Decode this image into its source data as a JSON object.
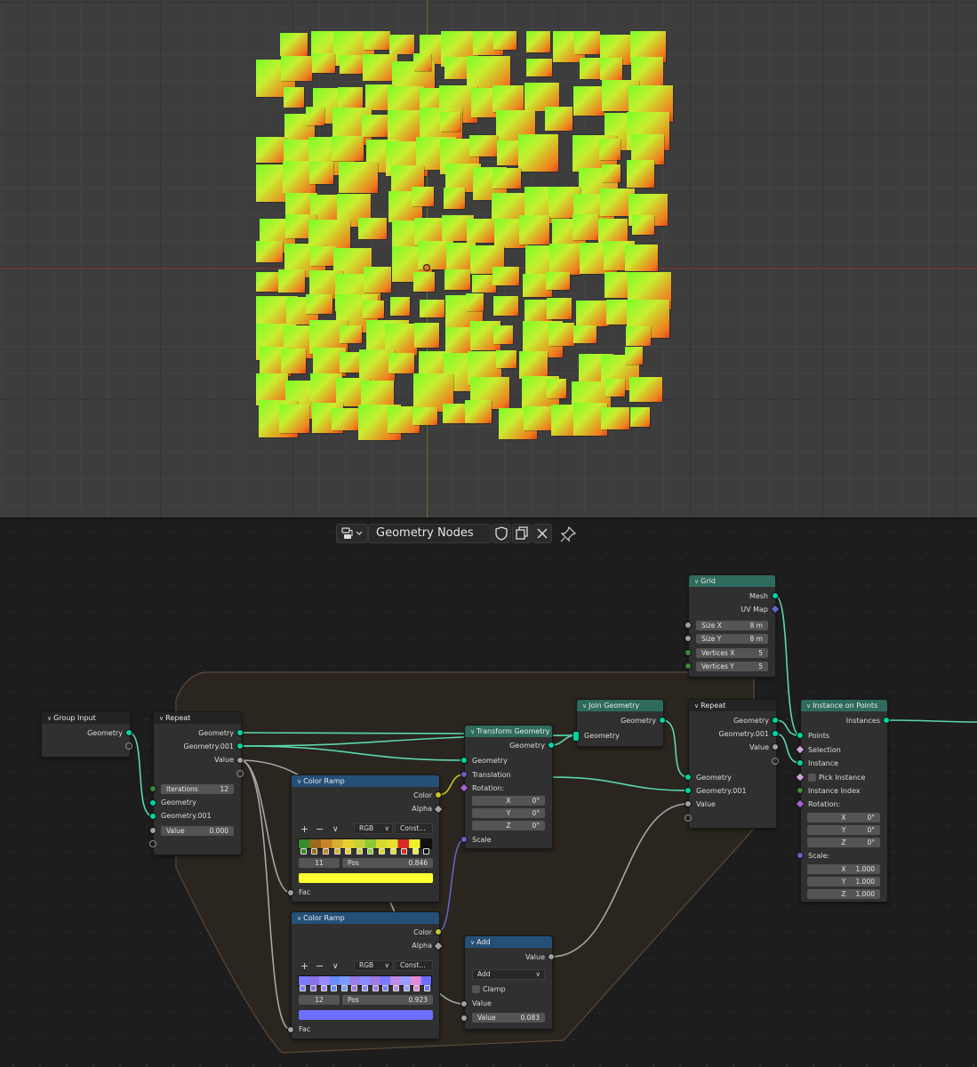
{
  "editor": {
    "tree_name": "Geometry Nodes",
    "colors": {
      "geometry_link": "#5cd6ad",
      "value_link": "#a6a6a6",
      "vector_link": "#6363c7",
      "color_link": "#c7c729",
      "frame_fill": "#2c2620",
      "frame_border": "#5a4a38"
    }
  },
  "nodes": {
    "grid": {
      "title": "Grid",
      "outputs": [
        "Mesh",
        "UV Map"
      ],
      "size_x": {
        "label": "Size X",
        "value": "8 m"
      },
      "size_y": {
        "label": "Size Y",
        "value": "8 m"
      },
      "vertices_x": {
        "label": "Vertices X",
        "value": "5"
      },
      "vertices_y": {
        "label": "Vertices Y",
        "value": "5"
      }
    },
    "group_input": {
      "title": "Group Input",
      "outputs": [
        "Geometry"
      ]
    },
    "repeat_input": {
      "title": "Repeat",
      "outputs": [
        "Geometry",
        "Geometry.001",
        "Value"
      ],
      "iterations": {
        "label": "Iterations",
        "value": "12"
      },
      "inputs": [
        "Geometry",
        "Geometry.001"
      ],
      "value": {
        "label": "Value",
        "value": "0.000"
      }
    },
    "color_ramp_1": {
      "title": "Color Ramp",
      "outputs": [
        "Color",
        "Alpha"
      ],
      "mode": "RGB",
      "interp": "Const...",
      "index": "11",
      "pos_label": "Pos",
      "pos": "0.846",
      "active_color": "#ffff33",
      "stops": [
        "#3a8a2a",
        "#9a6a1a",
        "#c8822a",
        "#d6b030",
        "#e6d030",
        "#c8d03a",
        "#8cc83a",
        "#d8d830",
        "#e6e030",
        "#d82a2a",
        "#f0f030",
        "#111111"
      ],
      "input": "Fac"
    },
    "color_ramp_2": {
      "title": "Color Ramp",
      "outputs": [
        "Color",
        "Alpha"
      ],
      "mode": "RGB",
      "interp": "Const...",
      "index": "12",
      "pos_label": "Pos",
      "pos": "0.923",
      "active_color": "#6e6eff",
      "stops": [
        "#7a7aff",
        "#8a70e6",
        "#9a8aff",
        "#6a8aff",
        "#7a9aff",
        "#9a7ae6",
        "#8a8aff",
        "#a07ae6",
        "#7a7aff",
        "#c08ae6",
        "#9a9aff",
        "#e08ad6",
        "#6e6eff"
      ],
      "input": "Fac"
    },
    "transform": {
      "title": "Transform Geometry",
      "outputs": [
        "Geometry"
      ],
      "inputs": [
        "Geometry",
        "Translation",
        "Rotation:",
        "Scale"
      ],
      "rotation": [
        {
          "label": "X",
          "value": "0°"
        },
        {
          "label": "Y",
          "value": "0°"
        },
        {
          "label": "Z",
          "value": "0°"
        }
      ]
    },
    "join": {
      "title": "Join Geometry",
      "outputs": [
        "Geometry"
      ],
      "inputs": [
        "Geometry"
      ]
    },
    "add": {
      "title": "Add",
      "outputs": [
        "Value"
      ],
      "operation": "Add",
      "clamp": "Clamp",
      "inputs": [
        "Value"
      ],
      "value": {
        "label": "Value",
        "value": "0.083"
      }
    },
    "repeat_output": {
      "title": "Repeat",
      "outputs": [
        "Geometry",
        "Geometry.001",
        "Value"
      ],
      "inputs": [
        "Geometry",
        "Geometry.001",
        "Value"
      ]
    },
    "instance_on_points": {
      "title": "Instance on Points",
      "outputs": [
        "Instances"
      ],
      "inputs": [
        "Points",
        "Selection",
        "Instance",
        "Pick Instance",
        "Instance Index",
        "Rotation:",
        "Scale:"
      ],
      "rotation": [
        {
          "label": "X",
          "value": "0°"
        },
        {
          "label": "Y",
          "value": "0°"
        },
        {
          "label": "Z",
          "value": "0°"
        }
      ],
      "scale": [
        {
          "label": "X",
          "value": "1.000"
        },
        {
          "label": "Y",
          "value": "1.000"
        },
        {
          "label": "Z",
          "value": "1.000"
        }
      ]
    }
  }
}
